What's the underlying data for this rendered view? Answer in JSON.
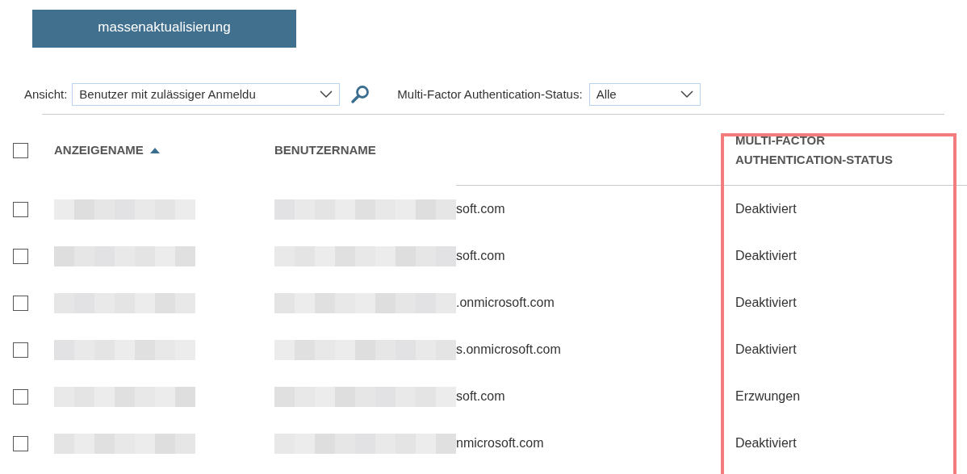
{
  "toolbar": {
    "bulk_update_button": "massenaktualisierung"
  },
  "filters": {
    "view_label": "Ansicht:",
    "view_value": "Benutzer mit zulässiger Anmeldu",
    "mfa_label": "Multi-Factor Authentication-Status:",
    "mfa_value": "Alle"
  },
  "table": {
    "select_all_checked": false,
    "columns": [
      {
        "label": "ANZEIGENAME",
        "sorted": true,
        "highlighted": false
      },
      {
        "label": "BENUTZERNAME",
        "sorted": false,
        "highlighted": false
      },
      {
        "label": "MULTI-FACTOR AUTHENTICATION-STATUS",
        "sorted": false,
        "highlighted": true
      }
    ],
    "rows": [
      {
        "checked": false,
        "username": "soft.com",
        "status": "Deaktiviert"
      },
      {
        "checked": false,
        "username": "soft.com",
        "status": "Deaktiviert"
      },
      {
        "checked": false,
        "username": ".onmicrosoft.com",
        "status": "Deaktiviert"
      },
      {
        "checked": false,
        "username": "s.onmicrosoft.com",
        "status": "Deaktiviert"
      },
      {
        "checked": false,
        "username": "soft.com",
        "status": "Erzwungen"
      },
      {
        "checked": false,
        "username": "nmicrosoft.com",
        "status": "Deaktiviert"
      }
    ]
  }
}
